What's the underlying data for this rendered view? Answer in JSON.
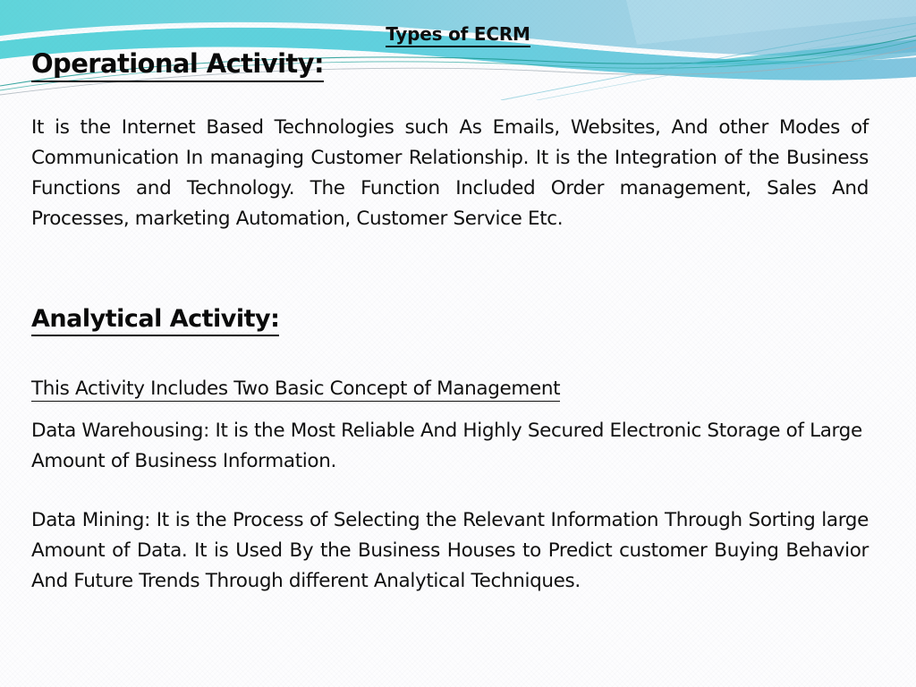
{
  "slide": {
    "title": "Types of ECRM",
    "accent_colors": {
      "cyan": "#62D6DA",
      "teal": "#3FBFCB",
      "sky": "#7FD4E6",
      "steel_blue": "#9FCFE3",
      "pale_blue": "#BFE2EE",
      "line_teal": "#189B94",
      "line_gray": "#9AA6AE",
      "background": "#FDFDFE",
      "text": "#101010"
    },
    "sections": [
      {
        "heading": "Operational Activity:",
        "body": "It is the Internet Based Technologies such As Emails, Websites, And other Modes of Communication In managing Customer Relationship. It is the Integration of the Business Functions and Technology. The Function Included Order management, Sales And Processes, marketing Automation, Customer Service Etc."
      },
      {
        "heading": "Analytical Activity:",
        "subheading": "This Activity Includes Two Basic Concept of Management",
        "points": [
          "Data Warehousing: It is the Most Reliable And Highly Secured Electronic Storage of Large Amount of Business Information.",
          "Data Mining: It is the Process of Selecting the Relevant Information Through Sorting large Amount of Data. It is Used By the Business Houses to Predict customer Buying Behavior And Future Trends Through different Analytical Techniques."
        ]
      }
    ]
  }
}
